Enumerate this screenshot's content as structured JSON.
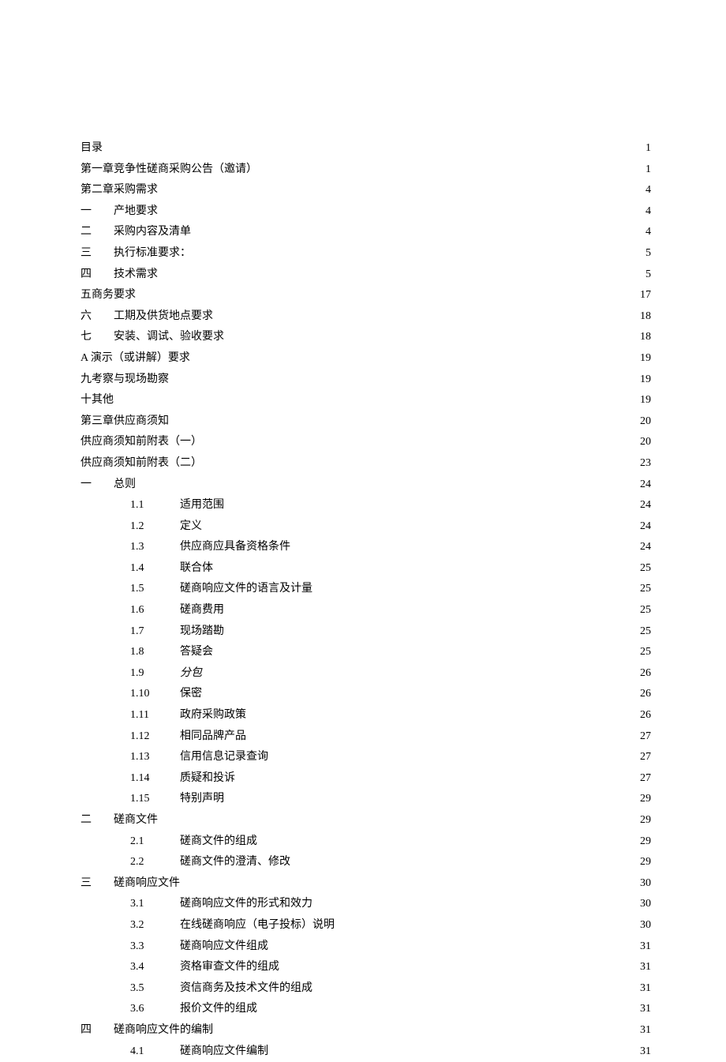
{
  "toc": [
    {
      "type": "top",
      "prefix": "",
      "label": "目录",
      "page": "1"
    },
    {
      "type": "top",
      "prefix": "",
      "label": "第一章竞争性磋商采购公告（邀请）",
      "page": "1"
    },
    {
      "type": "top",
      "prefix": "",
      "label": "第二章采购需求",
      "page": "4"
    },
    {
      "type": "sec",
      "prefix": "一",
      "label": "产地要求",
      "page": "4"
    },
    {
      "type": "sec",
      "prefix": "二",
      "label": "采购内容及清单",
      "page": "4"
    },
    {
      "type": "sec",
      "prefix": "三",
      "label": "执行标准要求：",
      "page": "5"
    },
    {
      "type": "sec",
      "prefix": "四",
      "label": "技术需求",
      "page": "5"
    },
    {
      "type": "top",
      "prefix": "",
      "label": "五商务要求",
      "page": "17"
    },
    {
      "type": "sec",
      "prefix": "六",
      "label": "工期及供货地点要求",
      "page": "18"
    },
    {
      "type": "sec",
      "prefix": "七",
      "label": "安装、调试、验收要求",
      "page": "18"
    },
    {
      "type": "top",
      "prefix": "",
      "label": "A 演示（或讲解）要求",
      "page": "19"
    },
    {
      "type": "top",
      "prefix": "",
      "label": "九考察与现场勘察",
      "page": "19"
    },
    {
      "type": "top",
      "prefix": "",
      "label": "十其他",
      "page": "19"
    },
    {
      "type": "top",
      "prefix": "",
      "label": "第三章供应商须知",
      "page": "20"
    },
    {
      "type": "top",
      "prefix": "",
      "label": "供应商须知前附表（一）",
      "page": "20"
    },
    {
      "type": "top",
      "prefix": "",
      "label": "供应商须知前附表（二）",
      "page": "23"
    },
    {
      "type": "sec",
      "prefix": "一",
      "label": "总则",
      "page": "24"
    },
    {
      "type": "sub",
      "prefix": "1.1",
      "label": "适用范围",
      "page": "24"
    },
    {
      "type": "sub",
      "prefix": "1.2",
      "label": "定义",
      "page": "24"
    },
    {
      "type": "sub",
      "prefix": "1.3",
      "label": "供应商应具备资格条件",
      "page": "24"
    },
    {
      "type": "sub",
      "prefix": "1.4",
      "label": "联合体",
      "page": "25"
    },
    {
      "type": "sub",
      "prefix": "1.5",
      "label": "磋商响应文件的语言及计量",
      "page": "25"
    },
    {
      "type": "sub",
      "prefix": "1.6",
      "label": "磋商费用",
      "page": "25"
    },
    {
      "type": "sub",
      "prefix": "1.7",
      "label": "现场踏勘",
      "page": "25"
    },
    {
      "type": "sub",
      "prefix": "1.8",
      "label": "答疑会",
      "page": "25"
    },
    {
      "type": "sub",
      "prefix": "1.9",
      "label": "分包",
      "page": "26",
      "italic": true
    },
    {
      "type": "sub",
      "prefix": "1.10",
      "label": "保密",
      "page": "26"
    },
    {
      "type": "sub",
      "prefix": "1.11",
      "label": "政府采购政策",
      "page": "26"
    },
    {
      "type": "sub",
      "prefix": "1.12",
      "label": "相同品牌产品",
      "page": "27"
    },
    {
      "type": "sub",
      "prefix": "1.13",
      "label": "信用信息记录查询",
      "page": "27"
    },
    {
      "type": "sub",
      "prefix": "1.14",
      "label": "质疑和投诉",
      "page": "27"
    },
    {
      "type": "sub",
      "prefix": "1.15",
      "label": "特别声明",
      "page": "29"
    },
    {
      "type": "sec",
      "prefix": "二",
      "label": "磋商文件",
      "page": "29"
    },
    {
      "type": "sub",
      "prefix": "2.1",
      "label": "磋商文件的组成",
      "page": "29"
    },
    {
      "type": "sub",
      "prefix": "2.2",
      "label": "磋商文件的澄清、修改",
      "page": "29"
    },
    {
      "type": "sec",
      "prefix": "三",
      "label": "磋商响应文件",
      "page": "30"
    },
    {
      "type": "sub",
      "prefix": "3.1",
      "label": "磋商响应文件的形式和效力",
      "page": "30"
    },
    {
      "type": "sub",
      "prefix": "3.2",
      "label": "在线磋商响应（电子投标）说明",
      "page": "30"
    },
    {
      "type": "sub",
      "prefix": "3.3",
      "label": "磋商响应文件组成",
      "page": "31"
    },
    {
      "type": "sub",
      "prefix": "3.4",
      "label": "资格审查文件的组成",
      "page": "31"
    },
    {
      "type": "sub",
      "prefix": "3.5",
      "label": "资信商务及技术文件的组成",
      "page": "31"
    },
    {
      "type": "sub",
      "prefix": "3.6",
      "label": "报价文件的组成",
      "page": "31"
    },
    {
      "type": "sec",
      "prefix": "四",
      "label": "磋商响应文件的编制",
      "page": "31"
    },
    {
      "type": "sub",
      "prefix": "4.1",
      "label": "磋商响应文件编制",
      "page": "31"
    }
  ]
}
